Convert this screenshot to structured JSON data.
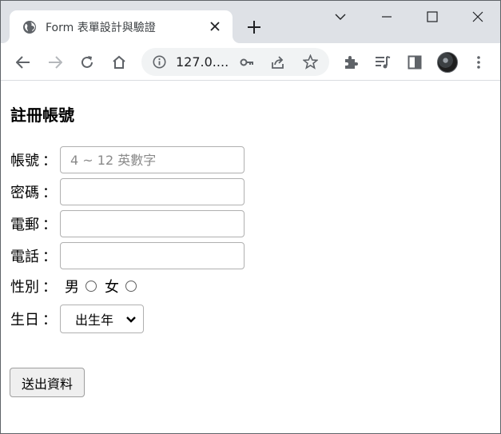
{
  "browser": {
    "tab_title": "Form 表單設計與驗證",
    "url_display": "127.0....",
    "colors": {
      "tabstrip_bg": "#dee1e6",
      "omnibox_bg": "#f1f3f4",
      "icon_color": "#5f6368"
    },
    "icons": {
      "tab_favicon": "globe-icon",
      "tab_close": "close-icon",
      "new_tab": "plus-icon",
      "back": "arrow-left-icon",
      "forward": "arrow-right-icon",
      "reload": "reload-icon",
      "home": "home-icon",
      "site_info": "info-icon",
      "password": "key-icon",
      "share": "share-icon",
      "bookmark": "star-icon",
      "extensions": "puzzle-icon",
      "media": "media-queue-icon",
      "side_panel": "side-panel-icon",
      "menu": "kebab-menu-icon",
      "tab_search": "chevron-down-icon",
      "minimize": "minimize-icon",
      "maximize": "maximize-icon",
      "close_window": "close-icon"
    }
  },
  "form": {
    "title": "註冊帳號",
    "colon": "：",
    "account": {
      "label": "帳號",
      "placeholder": "4 ~ 12 英數字",
      "value": ""
    },
    "password": {
      "label": "密碼",
      "value": ""
    },
    "email": {
      "label": "電郵",
      "value": ""
    },
    "phone": {
      "label": "電話",
      "value": ""
    },
    "gender": {
      "label": "性別",
      "options": [
        "男",
        "女"
      ]
    },
    "birthday": {
      "label": "生日",
      "selected": "出生年"
    },
    "submit_label": "送出資料"
  }
}
